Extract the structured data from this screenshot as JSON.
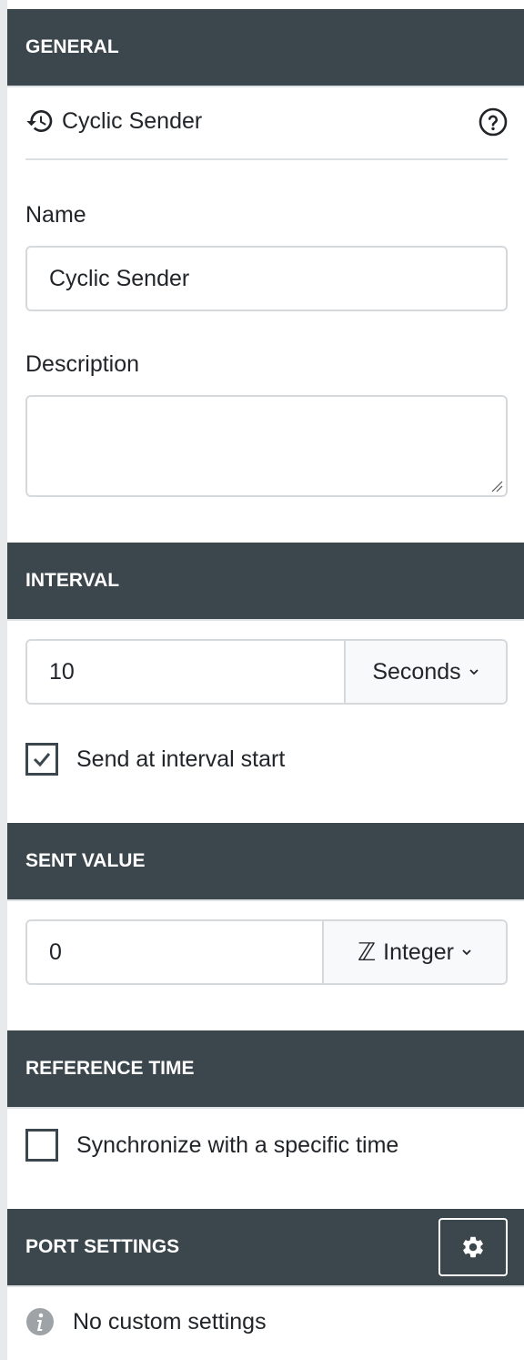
{
  "general": {
    "header": "GENERAL",
    "title": "Cyclic Sender",
    "name_label": "Name",
    "name_value": "Cyclic Sender",
    "description_label": "Description",
    "description_value": ""
  },
  "interval": {
    "header": "INTERVAL",
    "value": "10",
    "unit": "Seconds",
    "send_at_start_label": "Send at interval start",
    "send_at_start_checked": true
  },
  "sent_value": {
    "header": "SENT VALUE",
    "value": "0",
    "type_symbol": "ℤ",
    "type_label": "Integer"
  },
  "reference_time": {
    "header": "REFERENCE TIME",
    "sync_label": "Synchronize with a specific time",
    "sync_checked": false
  },
  "port_settings": {
    "header": "PORT SETTINGS",
    "info_text": "No custom settings"
  },
  "colors": {
    "header_bg": "#3b464d",
    "header_text": "#ffffff",
    "border": "#d6d9dc",
    "addon_bg": "#f8f9fa"
  },
  "icons": {
    "title": "history-icon",
    "help": "help-circle-icon",
    "gear": "gear-icon",
    "info": "info-icon",
    "check": "check-icon",
    "chevron": "chevron-down-icon"
  }
}
